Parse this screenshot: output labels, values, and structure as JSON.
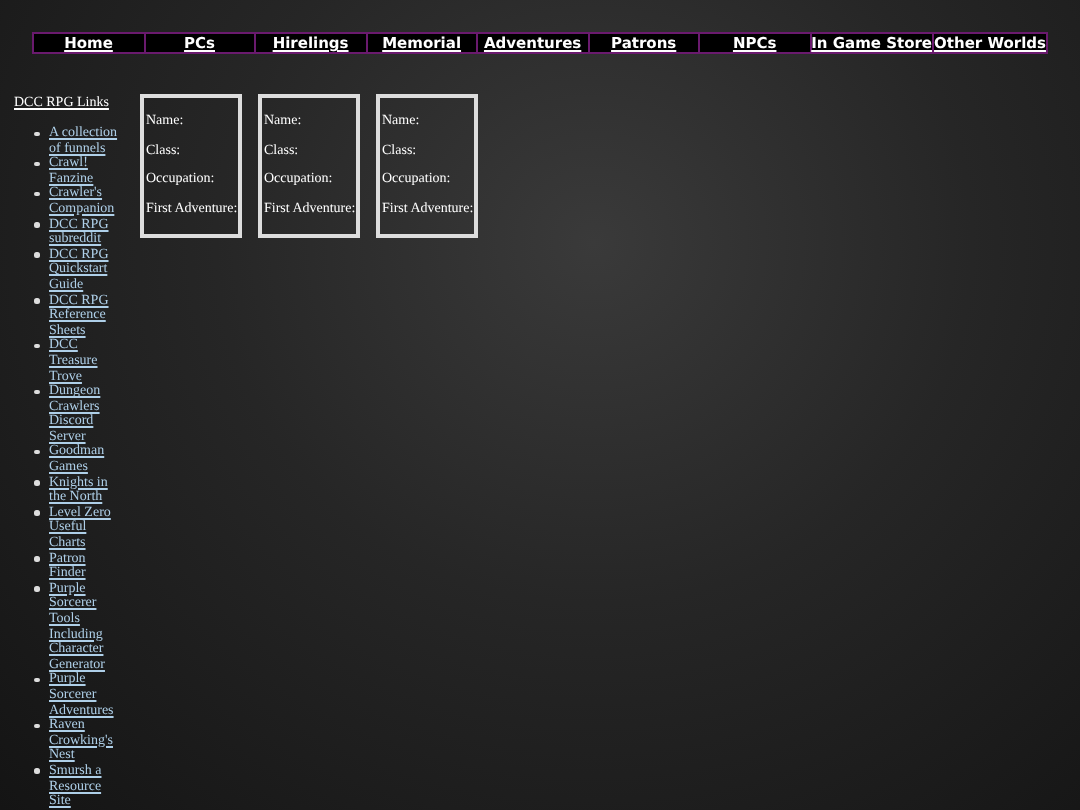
{
  "nav": [
    {
      "label": "Home"
    },
    {
      "label": "PCs"
    },
    {
      "label": "Hirelings"
    },
    {
      "label": "Memorial"
    },
    {
      "label": "Adventures"
    },
    {
      "label": "Patrons"
    },
    {
      "label": "NPCs"
    },
    {
      "label": "In Game Store"
    },
    {
      "label": "Other Worlds"
    }
  ],
  "sidebar": {
    "title": "DCC RPG Links",
    "links": [
      "A collection of funnels",
      "Crawl! Fanzine",
      "Crawler's Companion",
      "DCC RPG subreddit",
      "DCC RPG Quickstart Guide",
      "DCC RPG Reference Sheets",
      "DCC Treasure Trove",
      "Dungeon Crawlers Discord Server",
      "Goodman Games",
      "Knights in the North",
      "Level Zero Useful Charts",
      "Patron Finder",
      "Purple Sorcerer Tools Including Character Generator",
      "Purple Sorcerer Adventures",
      "Raven Crowking's Nest",
      "Smursh a Resource Site"
    ]
  },
  "cards": [
    {
      "fields": [
        "Name:",
        "Class:",
        "Occupation:",
        "First Adventure:"
      ]
    },
    {
      "fields": [
        "Name:",
        "Class:",
        "Occupation:",
        "First Adventure:"
      ]
    },
    {
      "fields": [
        "Name:",
        "Class:",
        "Occupation:",
        "First Adventure:"
      ]
    }
  ]
}
